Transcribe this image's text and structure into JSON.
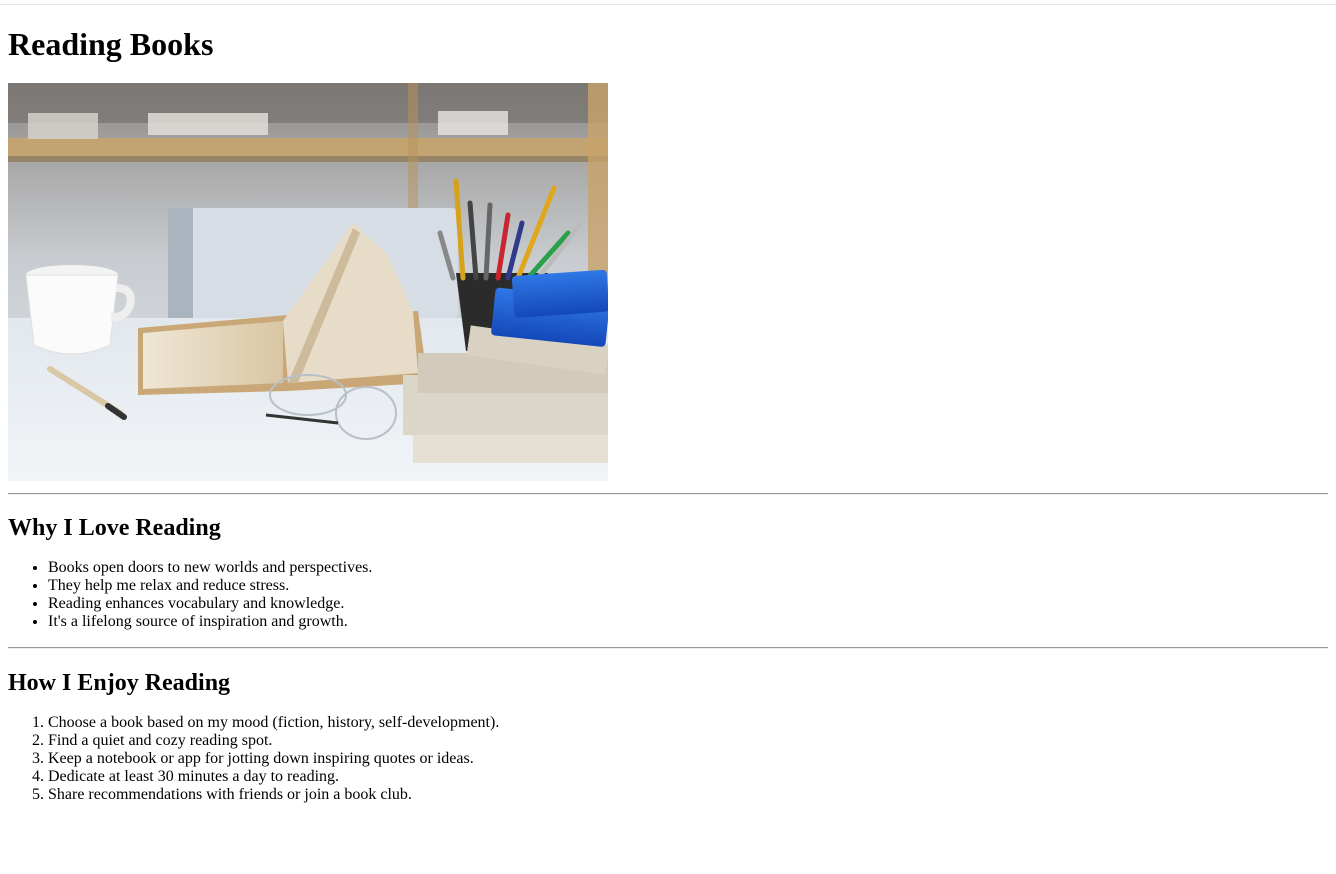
{
  "page": {
    "title": "Reading Books",
    "image": {
      "alt": "Books, pencil cup, coffee cup and glasses on a desk",
      "icon": "photo-of-books-on-desk"
    }
  },
  "sections": [
    {
      "heading": "Why I Love Reading",
      "list_type": "unordered",
      "items": [
        "Books open doors to new worlds and perspectives.",
        "They help me relax and reduce stress.",
        "Reading enhances vocabulary and knowledge.",
        "It's a lifelong source of inspiration and growth."
      ]
    },
    {
      "heading": "How I Enjoy Reading",
      "list_type": "ordered",
      "items": [
        "Choose a book based on my mood (fiction, history, self-development).",
        "Find a quiet and cozy reading spot.",
        "Keep a notebook or app for jotting down inspiring quotes or ideas.",
        "Dedicate at least 30 minutes a day to reading.",
        "Share recommendations with friends or join a book club."
      ]
    }
  ],
  "colors": {
    "book_blue": "#1f5fd1",
    "desk": "#e9edf1",
    "shelf_wood": "#c8a36a"
  }
}
